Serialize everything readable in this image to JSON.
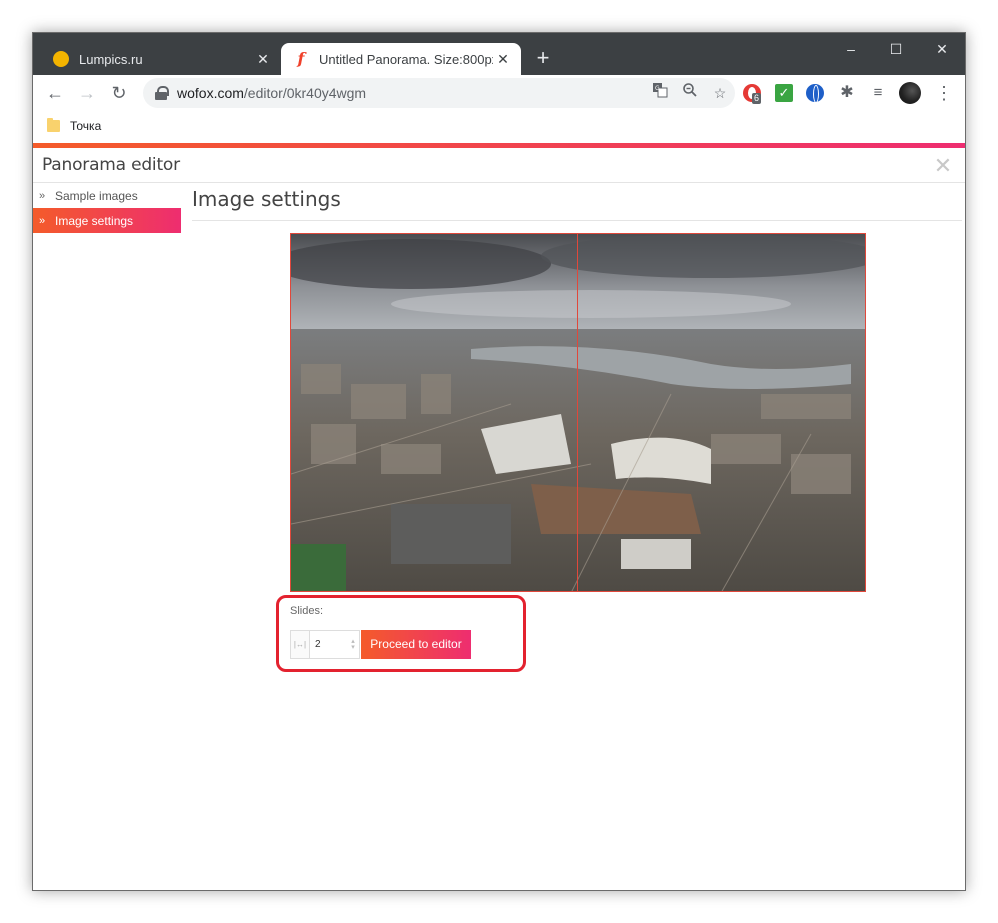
{
  "browser": {
    "tabs": [
      {
        "title": "Lumpics.ru",
        "active": false,
        "favicon": "lumpics-favicon"
      },
      {
        "title": "Untitled Panorama. Size:800px x",
        "active": true,
        "favicon": "wofox-favicon"
      }
    ],
    "new_tab_icon": "plus-icon",
    "window_controls": {
      "minimize": "–",
      "maximize": "☐",
      "close": "✕"
    },
    "tab_close_glyph": "✕",
    "nav": {
      "back": "←",
      "forward": "→",
      "reload": "↻"
    },
    "url": {
      "host": "wofox.com",
      "path": "/editor/0kr40y4wgm"
    },
    "extension_badge": "6",
    "bookmarks": [
      {
        "label": "Точка",
        "icon": "folder-icon"
      }
    ]
  },
  "editor": {
    "title": "Panorama editor",
    "close_glyph": "✕",
    "sidebar": [
      {
        "label": "Sample images",
        "active": false
      },
      {
        "label": "Image settings",
        "active": true
      }
    ],
    "section_title": "Image settings",
    "image": {
      "description_icon": "panorama-city-image"
    },
    "slides_label": "Slides:",
    "slides_value": "2",
    "proceed_label": "Proceed to editor"
  },
  "colors": {
    "accent_start": "#f45b2a",
    "accent_end": "#ee2d70",
    "highlight": "#e3222f",
    "tabstrip": "#3c4043"
  }
}
